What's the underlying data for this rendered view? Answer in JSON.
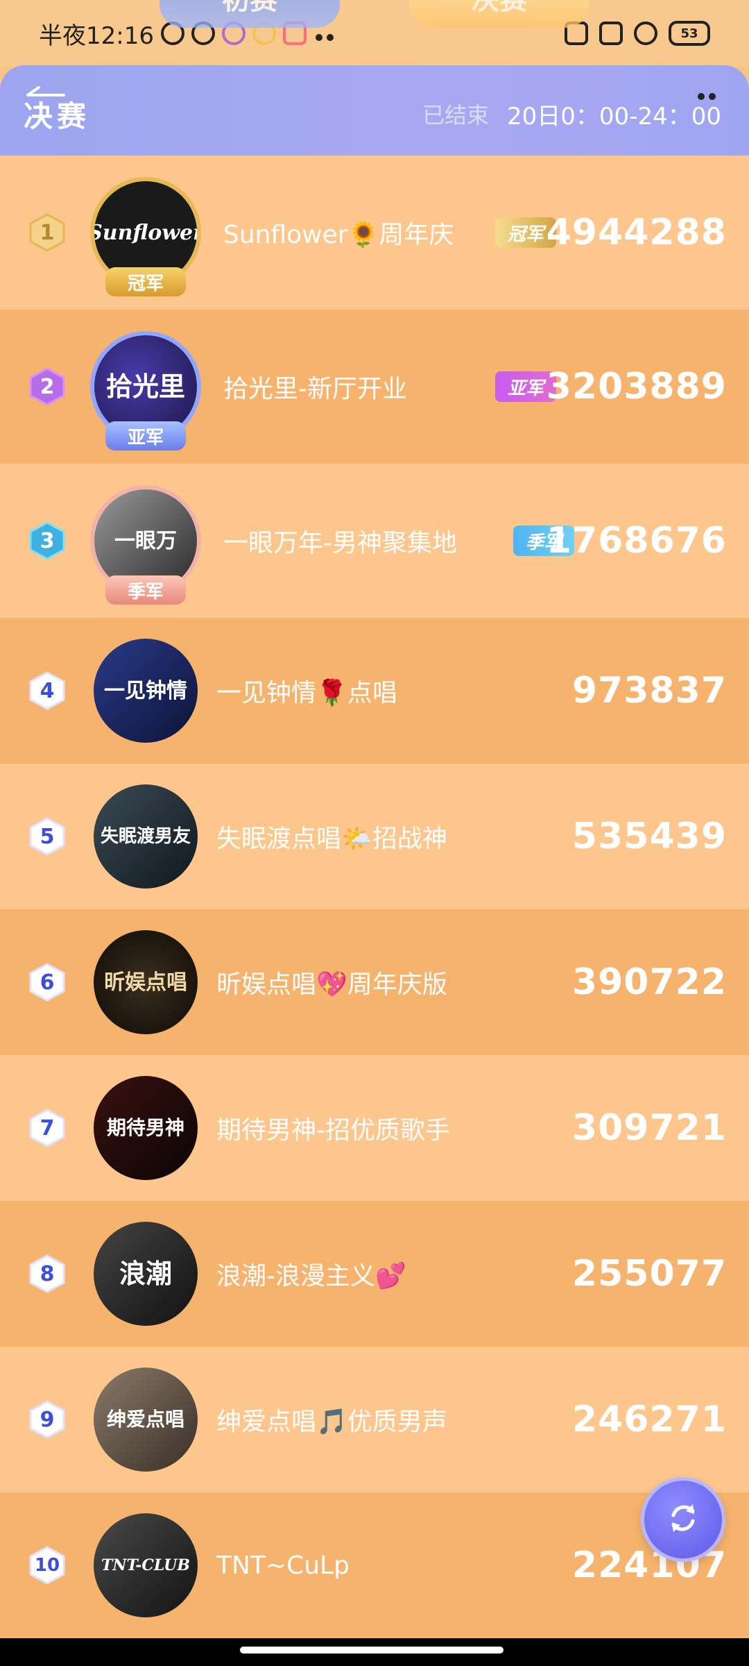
{
  "status_bar": {
    "time": "半夜12:16",
    "battery": "53"
  },
  "top_tabs": [
    "初赛",
    "决赛"
  ],
  "header": {
    "title": "决赛",
    "status": "已结束",
    "time_range": "20日0：00-24：00"
  },
  "list": [
    {
      "rank": "1",
      "name": "Sunflower🌻周年庆",
      "medal": "冠军",
      "score": "4944288",
      "avatar_text": "Sunflower",
      "ribbon": "冠军",
      "accent": "#d6a441"
    },
    {
      "rank": "2",
      "name": "拾光里-新厅开业",
      "medal": "亚军",
      "score": "3203889",
      "avatar_text": "拾光里",
      "ribbon": "亚军",
      "accent": "#9b6cf0"
    },
    {
      "rank": "3",
      "name": "一眼万年-男神聚集地",
      "medal": "季军",
      "score": "1768676",
      "avatar_text": "一眼万",
      "ribbon": "季军",
      "accent": "#4bb7e6"
    },
    {
      "rank": "4",
      "name": "一见钟情🌹点唱",
      "score": "973837",
      "avatar_text": "一见钟情"
    },
    {
      "rank": "5",
      "name": "失眠渡点唱🌤️招战神",
      "score": "535439",
      "avatar_text": "失眠渡男友"
    },
    {
      "rank": "6",
      "name": "昕娱点唱💖周年庆版",
      "score": "390722",
      "avatar_text": "昕娱点唱"
    },
    {
      "rank": "7",
      "name": "期待男神-招优质歌手",
      "score": "309721",
      "avatar_text": "期待男神"
    },
    {
      "rank": "8",
      "name": "浪潮-浪漫主义💕",
      "score": "255077",
      "avatar_text": "浪潮"
    },
    {
      "rank": "9",
      "name": "绅爱点唱🎵优质男声",
      "score": "246271",
      "avatar_text": "绅爱点唱"
    },
    {
      "rank": "10",
      "name": "TNT~CuLp",
      "score": "224107",
      "avatar_text": "TNT-CLUB"
    }
  ],
  "colors": {
    "row_light": "#fcc68c",
    "row_dark": "#f6b36d",
    "header_bg": "#a8a8f2",
    "fab": "#6a65f0"
  }
}
